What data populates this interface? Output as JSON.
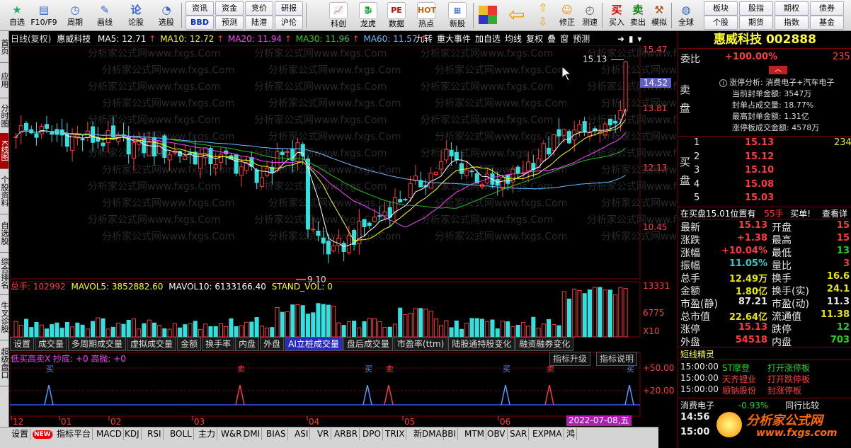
{
  "toolbar": {
    "left_buttons": [
      {
        "name": "zixuan",
        "icon": "★",
        "label": "自选",
        "color": "#2a6"
      },
      {
        "name": "f10",
        "icon": "▤",
        "label": "F10/F9",
        "color": "#36c"
      },
      {
        "name": "zhouqi",
        "icon": "◷",
        "label": "周期",
        "color": "#36c"
      },
      {
        "name": "huaxian",
        "icon": "✎",
        "label": "画线",
        "color": "#36c"
      },
      {
        "name": "lungu",
        "icon": "论",
        "label": "论股",
        "color": "#36c"
      },
      {
        "name": "xuangu",
        "icon": "◔",
        "label": "选股",
        "color": "#36c"
      }
    ],
    "grid_buttons": [
      "资讯",
      "资金",
      "竞价",
      "研报",
      "BBD",
      "预测",
      "陆港",
      "沪伦"
    ],
    "mid_buttons": [
      {
        "name": "kechuang",
        "icon": "📈",
        "label": "科创",
        "color": "#c44"
      },
      {
        "name": "longhu",
        "icon": "🐉",
        "label": "龙虎",
        "color": "#c00"
      },
      {
        "name": "shuju",
        "icon": "PE",
        "label": "数据",
        "color": "#c00"
      },
      {
        "name": "redian",
        "icon": "HOT",
        "label": "热点",
        "color": "#c60"
      },
      {
        "name": "xingu",
        "icon": "▦",
        "label": "新股",
        "color": "#36c"
      }
    ],
    "right_buttons": [
      {
        "name": "xiuzheng",
        "icon": "☺",
        "label": "修正",
        "color": "#e80"
      },
      {
        "name": "cesu",
        "icon": "◴",
        "label": "测速",
        "color": "#555"
      },
      {
        "name": "mairu",
        "icon": "买",
        "label": "买入",
        "color": "#d00"
      },
      {
        "name": "maichu",
        "icon": "卖",
        "label": "卖出",
        "color": "#080"
      },
      {
        "name": "moni",
        "icon": "⚒",
        "label": "模拟",
        "color": "#a40"
      },
      {
        "name": "quanqiu",
        "icon": "◍",
        "label": "全球",
        "color": "#36c"
      }
    ],
    "grid2_buttons": [
      "板块",
      "股指",
      "期权",
      "债券",
      "个股",
      "期货",
      "指数",
      "基金"
    ]
  },
  "left_tabs": [
    "首页",
    "应用",
    "分时图",
    "K线图",
    "个股资料",
    "自选股",
    "综合排名",
    "牛叉诊股",
    "超级盘口"
  ],
  "chart_header": {
    "period_label": "日线(复权)",
    "stock_name": "惠威科技",
    "ma5": "MA5: 12.71",
    "ma10": "MA10: 12.72",
    "ma20": "MA20: 11.94",
    "ma30": "MA30: 11.96",
    "ma60": "MA60: 11.57",
    "tools": [
      "九转",
      "重大事件",
      "加自选",
      "均线",
      "复权",
      "叠",
      "窗",
      "预测"
    ]
  },
  "watermark": "分析家公式网www.fxgs.Com",
  "price_axis": {
    "ticks": [
      "15.47",
      "13.81",
      "12.13",
      "10.45"
    ],
    "current": "14.52",
    "high_label": "15.13",
    "low_label": "9.10"
  },
  "volume_header": {
    "total": "总手: 102992",
    "mavol5": "MAVOL5: 3852882.60",
    "mavol10": "MAVOL10: 6133166.40",
    "stand": "STAND_VOL: 0"
  },
  "volume_axis": {
    "ticks": [
      "13331",
      "6775"
    ],
    "unit": "X10"
  },
  "indicator_tabs": [
    "设置",
    "成交量",
    "多周期成交量",
    "虚拟成交量",
    "金额",
    "换手率",
    "内盘",
    "外盘",
    "AI立桩成交量",
    "盘后成交量",
    "市盈率(ttm)",
    "陆股通持股变化",
    "融资融券变化"
  ],
  "signal_panel": {
    "title": "低买高卖X 抄底: +0 高抛: +0",
    "buttons": [
      "指标升级",
      "指标说明"
    ],
    "axis": [
      "+50.00",
      "+20.00"
    ],
    "buy_labels": [
      "买",
      "买",
      "买",
      "买",
      "买"
    ],
    "sell_labels": [
      "卖",
      "卖",
      "卖",
      "卖"
    ]
  },
  "date_axis": [
    "12",
    "01",
    "02",
    "03",
    "04",
    "05",
    "06"
  ],
  "date_cursor": "2022-07-08,五",
  "bottom_tabs": [
    "设置",
    "NEW",
    "指标平台",
    "MACD",
    "KDJ",
    "RSI",
    "BOLL",
    "主力",
    "W&R",
    "DMI",
    "BIAS",
    "ASI",
    "VR",
    "ARBR",
    "DPO",
    "TRIX",
    "新DMA",
    "BBI",
    "MTM",
    "OBV",
    "SAR",
    "EXPMA",
    "鸿"
  ],
  "right_panel": {
    "title": "惠威科技 002888",
    "weibi_label": "委比",
    "weibi_value": "+100.00%",
    "weibi_extra": "235",
    "sell_label": "卖盘",
    "zt_analysis": "涨停分析: 消费电子+汽车电子",
    "zt_rows": [
      "当前封单金额: 3547万",
      "封单占成交量: 18.77%",
      "最高封单金额: 1.31亿",
      "涨停板成交金额: 4578万"
    ],
    "buy_label": "买盘",
    "buy_levels": [
      {
        "lvl": "1",
        "price": "15.13",
        "vol": "234"
      },
      {
        "lvl": "2",
        "price": "15.12",
        "vol": ""
      },
      {
        "lvl": "3",
        "price": "15.10",
        "vol": ""
      },
      {
        "lvl": "4",
        "price": "15.08",
        "vol": ""
      },
      {
        "lvl": "5",
        "price": "15.03",
        "vol": ""
      }
    ],
    "queue_line": {
      "text": "在买盘15.01位置有",
      "qty": "55手",
      "action": "买单!",
      "link": "查看详"
    },
    "quotes": [
      {
        "k1": "最新",
        "v1": "15.13",
        "k2": "开盘",
        "v2": "15",
        "c1": "red",
        "c2": "red"
      },
      {
        "k1": "涨跌",
        "v1": "+1.38",
        "k2": "最高",
        "v2": "15",
        "c1": "red",
        "c2": "red"
      },
      {
        "k1": "涨幅",
        "v1": "+10.04%",
        "k2": "最低",
        "v2": "13",
        "c1": "red",
        "c2": "grn"
      },
      {
        "k1": "振幅",
        "v1": "11.05%",
        "k2": "量比",
        "v2": "3",
        "c1": "cyn",
        "c2": "red"
      },
      {
        "k1": "总手",
        "v1": "12.49万",
        "k2": "换手",
        "v2": "16.6",
        "c1": "yel",
        "c2": "yel"
      },
      {
        "k1": "金额",
        "v1": "1.80亿",
        "k2": "换手(实)",
        "v2": "24.1",
        "c1": "yel",
        "c2": "yel"
      },
      {
        "k1": "市盈(静)",
        "v1": "87.21",
        "k2": "市盈(动)",
        "v2": "11.3",
        "c1": "wht",
        "c2": "wht"
      },
      {
        "k1": "总市值",
        "v1": "22.64亿",
        "k2": "流通值",
        "v2": "11.38",
        "c1": "yel",
        "c2": "yel"
      },
      {
        "k1": "涨停",
        "v1": "15.13",
        "k2": "跌停",
        "v2": "12",
        "c1": "red",
        "c2": "grn"
      },
      {
        "k1": "外盘",
        "v1": "54518",
        "k2": "内盘",
        "v2": "703",
        "c1": "red",
        "c2": "grn"
      }
    ],
    "sprite_title": "短线精灵",
    "sprites": [
      {
        "time": "15:00:00",
        "stock": "ST摩登",
        "event": "打开涨停板",
        "sc": "grn",
        "ec": "grn"
      },
      {
        "time": "15:00:00",
        "stock": "天齐锂业",
        "event": "打开跌停板",
        "sc": "red",
        "ec": "red"
      },
      {
        "time": "15:00:00",
        "stock": "顺钠股份",
        "event": "封涨停板",
        "sc": "red",
        "ec": "red"
      }
    ],
    "sector_line": {
      "name": "消费电子",
      "pct": "-0.93%",
      "extra": "同行比较"
    },
    "times": [
      "14:56",
      "15:00"
    ]
  },
  "logo": {
    "text": "分析家公式网",
    "url": "www.fxgs.com"
  },
  "colors": {
    "up": "#ff3c3c",
    "down": "#33e0e0",
    "ma5": "#ffffff",
    "ma10": "#ffff00",
    "ma20": "#ff40ff",
    "ma30": "#22c022",
    "ma60": "#66bbff"
  }
}
